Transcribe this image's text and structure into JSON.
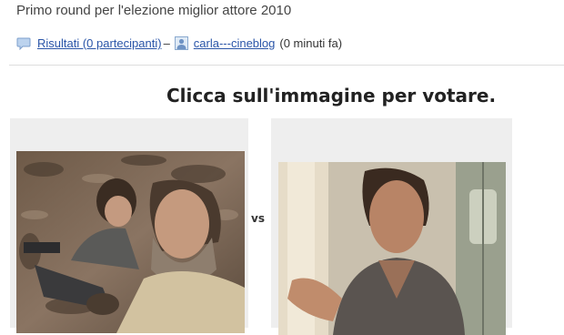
{
  "post": {
    "subtitle": "Primo round per l'elezione miglior attore 2010",
    "results_link": "Risultati (0 partecipanti)",
    "separator": " –",
    "author": "carla---cineblog",
    "time_ago": "(0 minuti fa)"
  },
  "poll": {
    "instruction": "Clicca sull'immagine per votare.",
    "versus": "vs"
  },
  "colors": {
    "link": "#2a55a8",
    "card_background": "#eeeeee",
    "divider": "#dddddd"
  },
  "icons": {
    "comment": "speech-bubble-icon",
    "user": "user-avatar-icon"
  }
}
